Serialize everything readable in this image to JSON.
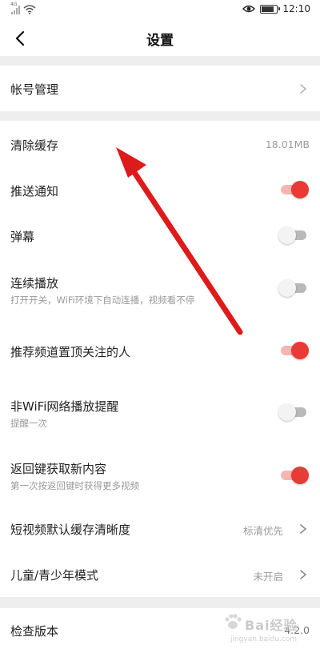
{
  "status_bar": {
    "signal_tag": "4G",
    "time": "12:10",
    "battery_level_percent": 90
  },
  "header": {
    "title": "设置"
  },
  "account": {
    "label": "帐号管理"
  },
  "settings": {
    "clear_cache": {
      "label": "清除缓存",
      "value": "18.01MB"
    },
    "push": {
      "label": "推送通知",
      "enabled": true
    },
    "danmaku": {
      "label": "弹幕",
      "enabled": false
    },
    "autoplay": {
      "label": "连续播放",
      "sub": "打开开关，WiFi环境下自动连播，视频看不停",
      "enabled": false
    },
    "pin_channel": {
      "label": "推荐频道置顶关注的人",
      "enabled": true
    },
    "non_wifi": {
      "label": "非WiFi网络播放提醒",
      "sub": "提醒一次",
      "enabled": false
    },
    "back_refresh": {
      "label": "返回键获取新内容",
      "sub": "第一次按返回键时获得更多视频",
      "enabled": true
    },
    "cache_quality": {
      "label": "短视频默认缓存清晰度",
      "value": "标清优先"
    },
    "kids_mode": {
      "label": "儿童/青少年模式",
      "value": "未开启"
    }
  },
  "version": {
    "label": "检查版本",
    "value": "4.2.0"
  },
  "watermark": {
    "text": "Bai经验",
    "url": "jingyan.baidu.com"
  },
  "colors": {
    "accent": "#e83b36",
    "annotation_arrow": "#dd1b1b",
    "divider_gap": "#eeeeee"
  }
}
